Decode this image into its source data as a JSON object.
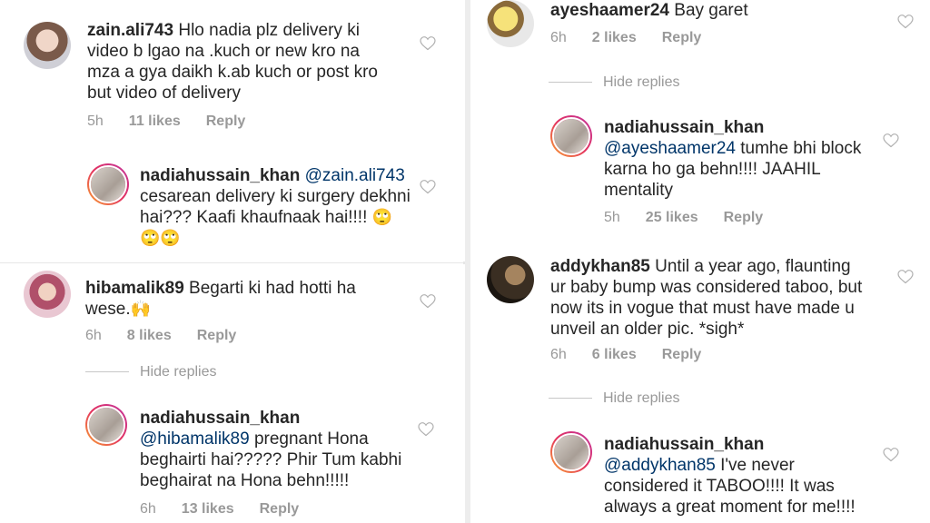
{
  "panels": {
    "top_left": {
      "comment": {
        "username": "zain.ali743",
        "text": " Hlo nadia plz delivery ki video b lgao na .kuch or new kro na mza a gya daikh k.ab kuch or post kro but video of delivery",
        "time": "5h",
        "likes": "11 likes",
        "reply": "Reply"
      },
      "reply": {
        "username": "nadiahussain_khan",
        "mention": "@zain.ali743",
        "text": " cesarean delivery ki surgery dekhni hai??? Kaafi khaufnaak hai!!!!",
        "emoji": "🙄🙄🙄"
      }
    },
    "bottom_left": {
      "comment": {
        "username": "hibamalik89",
        "text": " Begarti ki had hotti ha wese.",
        "emoji": "🙌",
        "time": "6h",
        "likes": "8 likes",
        "reply": "Reply"
      },
      "hide_replies": "Hide replies",
      "reply": {
        "username": "nadiahussain_khan",
        "mention": "@hibamalik89",
        "text": " pregnant Hona beghairti hai????? Phir Tum kabhi beghairat na Hona behn!!!!!",
        "time": "6h",
        "likes": "13 likes",
        "reply": "Reply"
      }
    },
    "right": {
      "comment1": {
        "username": "ayeshaamer24",
        "text": " Bay garet",
        "time": "6h",
        "likes": "2 likes",
        "reply": "Reply"
      },
      "hide_replies1": "Hide replies",
      "reply1": {
        "username": "nadiahussain_khan",
        "mention": "@ayeshaamer24",
        "text": " tumhe bhi block karna ho ga behn!!!! JAAHIL mentality",
        "time": "5h",
        "likes": "25 likes",
        "reply": "Reply"
      },
      "comment2": {
        "username": "addykhan85",
        "text": " Until a year ago, flaunting ur baby bump was considered taboo, but now its in vogue that must have made u unveil an older pic. *sigh*",
        "time": "6h",
        "likes": "6 likes",
        "reply": "Reply"
      },
      "hide_replies2": "Hide replies",
      "reply2": {
        "username": "nadiahussain_khan",
        "mention": "@addykhan85",
        "text": " I've never considered it TABOO!!!! It was always a great moment for me!!!!"
      }
    }
  },
  "colors": {
    "username": "#262626",
    "mention": "#003569",
    "meta": "#999999",
    "heart": "#b0b0b0"
  },
  "icons": {
    "like": "heart-outline-icon"
  }
}
